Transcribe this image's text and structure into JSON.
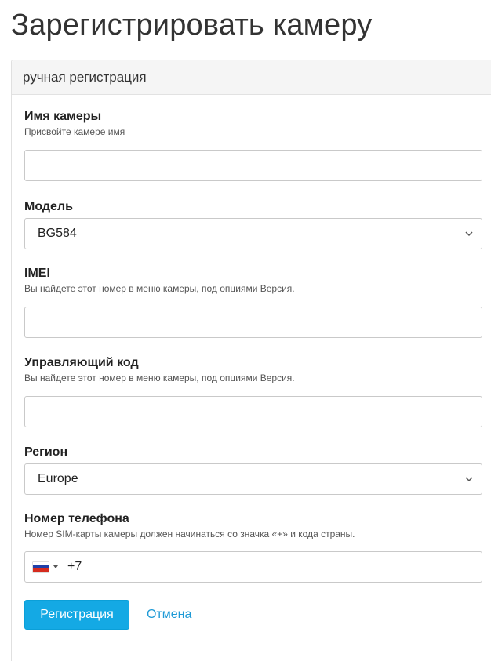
{
  "page": {
    "title": "Зарегистрировать камеру"
  },
  "panel": {
    "heading": "ручная регистрация"
  },
  "form": {
    "camera_name": {
      "label": "Имя камеры",
      "help": "Присвойте камере имя",
      "value": ""
    },
    "model": {
      "label": "Модель",
      "selected": "BG584"
    },
    "imei": {
      "label": "IMEI",
      "help": "Вы найдете этот номер в меню камеры, под опциями Версия.",
      "value": ""
    },
    "control_code": {
      "label": "Управляющий код",
      "help": "Вы найдете этот номер в меню камеры, под опциями Версия.",
      "value": ""
    },
    "region": {
      "label": "Регион",
      "selected": "Europe"
    },
    "phone": {
      "label": "Номер телефона",
      "help": "Номер SIM-карты камеры должен начинаться со значка «+» и кода страны.",
      "value": "+7",
      "flag_icon": "russia-flag-icon"
    }
  },
  "actions": {
    "register_label": "Регистрация",
    "cancel_label": "Отмена"
  },
  "colors": {
    "primary": "#14a9e4",
    "link": "#1e9ad6",
    "panel_heading_bg": "#f5f5f5"
  }
}
